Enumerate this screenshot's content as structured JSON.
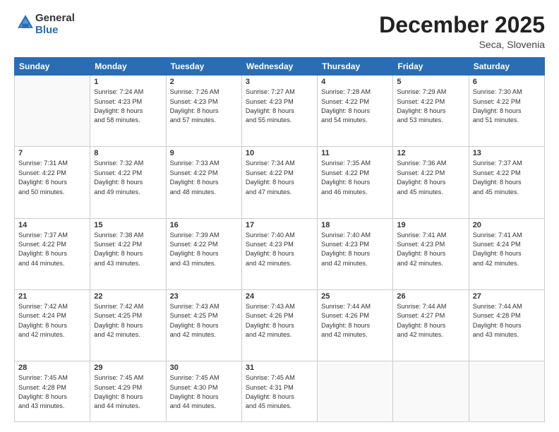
{
  "logo": {
    "general": "General",
    "blue": "Blue"
  },
  "header": {
    "month": "December 2025",
    "location": "Seca, Slovenia"
  },
  "weekdays": [
    "Sunday",
    "Monday",
    "Tuesday",
    "Wednesday",
    "Thursday",
    "Friday",
    "Saturday"
  ],
  "weeks": [
    [
      {
        "day": "",
        "info": ""
      },
      {
        "day": "1",
        "info": "Sunrise: 7:24 AM\nSunset: 4:23 PM\nDaylight: 8 hours\nand 58 minutes."
      },
      {
        "day": "2",
        "info": "Sunrise: 7:26 AM\nSunset: 4:23 PM\nDaylight: 8 hours\nand 57 minutes."
      },
      {
        "day": "3",
        "info": "Sunrise: 7:27 AM\nSunset: 4:23 PM\nDaylight: 8 hours\nand 55 minutes."
      },
      {
        "day": "4",
        "info": "Sunrise: 7:28 AM\nSunset: 4:22 PM\nDaylight: 8 hours\nand 54 minutes."
      },
      {
        "day": "5",
        "info": "Sunrise: 7:29 AM\nSunset: 4:22 PM\nDaylight: 8 hours\nand 53 minutes."
      },
      {
        "day": "6",
        "info": "Sunrise: 7:30 AM\nSunset: 4:22 PM\nDaylight: 8 hours\nand 51 minutes."
      }
    ],
    [
      {
        "day": "7",
        "info": "Sunrise: 7:31 AM\nSunset: 4:22 PM\nDaylight: 8 hours\nand 50 minutes."
      },
      {
        "day": "8",
        "info": "Sunrise: 7:32 AM\nSunset: 4:22 PM\nDaylight: 8 hours\nand 49 minutes."
      },
      {
        "day": "9",
        "info": "Sunrise: 7:33 AM\nSunset: 4:22 PM\nDaylight: 8 hours\nand 48 minutes."
      },
      {
        "day": "10",
        "info": "Sunrise: 7:34 AM\nSunset: 4:22 PM\nDaylight: 8 hours\nand 47 minutes."
      },
      {
        "day": "11",
        "info": "Sunrise: 7:35 AM\nSunset: 4:22 PM\nDaylight: 8 hours\nand 46 minutes."
      },
      {
        "day": "12",
        "info": "Sunrise: 7:36 AM\nSunset: 4:22 PM\nDaylight: 8 hours\nand 45 minutes."
      },
      {
        "day": "13",
        "info": "Sunrise: 7:37 AM\nSunset: 4:22 PM\nDaylight: 8 hours\nand 45 minutes."
      }
    ],
    [
      {
        "day": "14",
        "info": "Sunrise: 7:37 AM\nSunset: 4:22 PM\nDaylight: 8 hours\nand 44 minutes."
      },
      {
        "day": "15",
        "info": "Sunrise: 7:38 AM\nSunset: 4:22 PM\nDaylight: 8 hours\nand 43 minutes."
      },
      {
        "day": "16",
        "info": "Sunrise: 7:39 AM\nSunset: 4:22 PM\nDaylight: 8 hours\nand 43 minutes."
      },
      {
        "day": "17",
        "info": "Sunrise: 7:40 AM\nSunset: 4:23 PM\nDaylight: 8 hours\nand 42 minutes."
      },
      {
        "day": "18",
        "info": "Sunrise: 7:40 AM\nSunset: 4:23 PM\nDaylight: 8 hours\nand 42 minutes."
      },
      {
        "day": "19",
        "info": "Sunrise: 7:41 AM\nSunset: 4:23 PM\nDaylight: 8 hours\nand 42 minutes."
      },
      {
        "day": "20",
        "info": "Sunrise: 7:41 AM\nSunset: 4:24 PM\nDaylight: 8 hours\nand 42 minutes."
      }
    ],
    [
      {
        "day": "21",
        "info": "Sunrise: 7:42 AM\nSunset: 4:24 PM\nDaylight: 8 hours\nand 42 minutes."
      },
      {
        "day": "22",
        "info": "Sunrise: 7:42 AM\nSunset: 4:25 PM\nDaylight: 8 hours\nand 42 minutes."
      },
      {
        "day": "23",
        "info": "Sunrise: 7:43 AM\nSunset: 4:25 PM\nDaylight: 8 hours\nand 42 minutes."
      },
      {
        "day": "24",
        "info": "Sunrise: 7:43 AM\nSunset: 4:26 PM\nDaylight: 8 hours\nand 42 minutes."
      },
      {
        "day": "25",
        "info": "Sunrise: 7:44 AM\nSunset: 4:26 PM\nDaylight: 8 hours\nand 42 minutes."
      },
      {
        "day": "26",
        "info": "Sunrise: 7:44 AM\nSunset: 4:27 PM\nDaylight: 8 hours\nand 42 minutes."
      },
      {
        "day": "27",
        "info": "Sunrise: 7:44 AM\nSunset: 4:28 PM\nDaylight: 8 hours\nand 43 minutes."
      }
    ],
    [
      {
        "day": "28",
        "info": "Sunrise: 7:45 AM\nSunset: 4:28 PM\nDaylight: 8 hours\nand 43 minutes."
      },
      {
        "day": "29",
        "info": "Sunrise: 7:45 AM\nSunset: 4:29 PM\nDaylight: 8 hours\nand 44 minutes."
      },
      {
        "day": "30",
        "info": "Sunrise: 7:45 AM\nSunset: 4:30 PM\nDaylight: 8 hours\nand 44 minutes."
      },
      {
        "day": "31",
        "info": "Sunrise: 7:45 AM\nSunset: 4:31 PM\nDaylight: 8 hours\nand 45 minutes."
      },
      {
        "day": "",
        "info": ""
      },
      {
        "day": "",
        "info": ""
      },
      {
        "day": "",
        "info": ""
      }
    ]
  ]
}
